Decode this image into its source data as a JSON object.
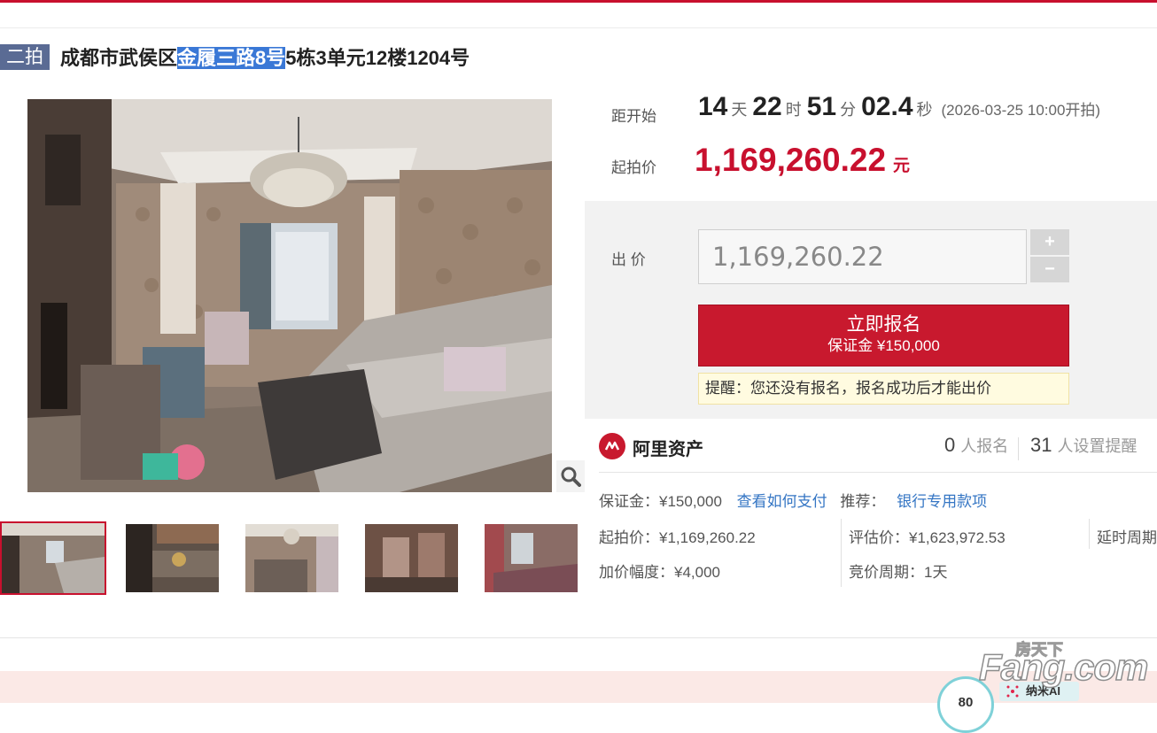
{
  "title": {
    "badge": "二拍",
    "prefix": "成都市武侯区",
    "highlight": "金履三路8号",
    "suffix": "5栋3单元12楼1204号"
  },
  "countdown": {
    "label": "距开始",
    "days": "14",
    "days_unit": "天",
    "hours": "22",
    "hours_unit": "时",
    "minutes": "51",
    "minutes_unit": "分",
    "seconds": "02.4",
    "seconds_unit": "秒",
    "start_note": "(2026-03-25 10:00开拍)"
  },
  "start_price": {
    "label": "起拍价",
    "value": "1,169,260.22",
    "unit": "元"
  },
  "bid": {
    "label": "出 价",
    "input_value": "1,169,260.22",
    "plus": "+",
    "minus": "−"
  },
  "signup": {
    "title": "立即报名",
    "deposit": "保证金 ¥150,000"
  },
  "notice": "提醒：您还没有报名，报名成功后才能出价",
  "platform": {
    "name": "阿里资产",
    "registrants_count": "0",
    "registrants_label": "人报名",
    "reminders_count": "31",
    "reminders_label": "人设置提醒"
  },
  "info": {
    "deposit": "保证金：¥150,000",
    "how_to_pay": "查看如何支付",
    "recommend_label": "推荐：",
    "recommend_link": "银行专用款项",
    "start_price": "起拍价：¥1,169,260.22",
    "appraisal": "评估价：¥1,623,972.53",
    "delay": "延时周期",
    "increment": "加价幅度：¥4,000",
    "bid_period": "竞价周期：1天"
  },
  "footer": {
    "circle_text": "80",
    "nami": "纳米AI",
    "watermark_small": "房天下",
    "watermark_big": "Fang.com"
  },
  "colors": {
    "accent_red": "#c8102e",
    "badge_blue": "#5a6b94",
    "link_blue": "#3576c4",
    "notice_bg": "#fffbe0"
  }
}
